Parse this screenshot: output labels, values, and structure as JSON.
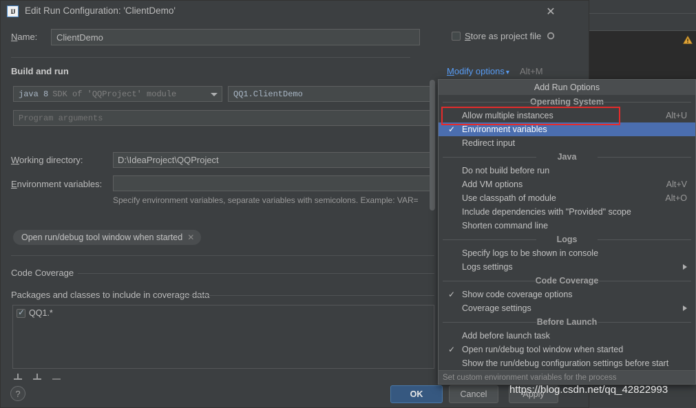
{
  "window": {
    "title": "Edit Run Configuration: 'ClientDemo'",
    "app_icon": "intellij-idea-icon",
    "close_icon": "close-icon"
  },
  "form": {
    "name_label": "Name:",
    "name_value": "ClientDemo",
    "store_as_project_file_label": "Store as project file",
    "store_as_project_file_checked": false,
    "gear_icon": "gear-icon"
  },
  "build_and_run": {
    "section_title": "Build and run",
    "modify_options_label": "Modify options",
    "modify_options_accel": "Alt+M",
    "jre_combo_bold": "java 8",
    "jre_combo_muted": "SDK of 'QQProject' module",
    "main_class": "QQ1.ClientDemo",
    "program_arguments_placeholder": "Program arguments",
    "working_directory_label": "Working directory:",
    "working_directory_value": "D:\\IdeaProject\\QQProject",
    "environment_variables_label": "Environment variables:",
    "environment_variables_value": "",
    "environment_variables_hint": "Specify environment variables, separate variables with semicolons. Example: VAR=",
    "tag_label": "Open run/debug tool window when started",
    "tag_close_icon": "close-icon"
  },
  "code_coverage": {
    "section_title": "Code Coverage",
    "packages_title": "Packages and classes to include in coverage data",
    "rows": [
      {
        "label": "QQ1.*",
        "checked": true
      }
    ],
    "toolbar": [
      {
        "name": "add-package-button",
        "glyph": "+"
      },
      {
        "name": "add-class-button",
        "glyph": "+"
      },
      {
        "name": "remove-button",
        "glyph": "−"
      }
    ]
  },
  "footer": {
    "help_label": "?",
    "ok_label": "OK",
    "cancel_label": "Cancel",
    "apply_label": "Apply"
  },
  "menu": {
    "title": "Add Run Options",
    "status_text": "Set custom environment variables for the process",
    "sections": [
      {
        "group": "Operating System",
        "items": [
          {
            "label": "Allow multiple instances",
            "accel": "Alt+U",
            "checked": false,
            "selected": false,
            "submenu": false,
            "highlighted": true
          },
          {
            "label": "Environment variables",
            "accel": "",
            "checked": true,
            "selected": true,
            "submenu": false,
            "highlighted": false
          },
          {
            "label": "Redirect input",
            "accel": "",
            "checked": false,
            "selected": false,
            "submenu": false,
            "highlighted": false
          }
        ]
      },
      {
        "group": "Java",
        "items": [
          {
            "label": "Do not build before run",
            "accel": "",
            "checked": false,
            "selected": false,
            "submenu": false,
            "highlighted": false
          },
          {
            "label": "Add VM options",
            "accel": "Alt+V",
            "checked": false,
            "selected": false,
            "submenu": false,
            "highlighted": false
          },
          {
            "label": "Use classpath of module",
            "accel": "Alt+O",
            "checked": false,
            "selected": false,
            "submenu": false,
            "highlighted": false
          },
          {
            "label": "Include dependencies with \"Provided\" scope",
            "accel": "",
            "checked": false,
            "selected": false,
            "submenu": false,
            "highlighted": false
          },
          {
            "label": "Shorten command line",
            "accel": "",
            "checked": false,
            "selected": false,
            "submenu": false,
            "highlighted": false
          }
        ]
      },
      {
        "group": "Logs",
        "items": [
          {
            "label": "Specify logs to be shown in console",
            "accel": "",
            "checked": false,
            "selected": false,
            "submenu": false,
            "highlighted": false
          },
          {
            "label": "Logs settings",
            "accel": "",
            "checked": false,
            "selected": false,
            "submenu": true,
            "highlighted": false
          }
        ]
      },
      {
        "group": "Code Coverage",
        "items": [
          {
            "label": "Show code coverage options",
            "accel": "",
            "checked": true,
            "selected": false,
            "submenu": false,
            "highlighted": false
          },
          {
            "label": "Coverage settings",
            "accel": "",
            "checked": false,
            "selected": false,
            "submenu": true,
            "highlighted": false
          }
        ]
      },
      {
        "group": "Before Launch",
        "items": [
          {
            "label": "Add before launch task",
            "accel": "",
            "checked": false,
            "selected": false,
            "submenu": false,
            "highlighted": false
          },
          {
            "label": "Open run/debug tool window when started",
            "accel": "",
            "checked": true,
            "selected": false,
            "submenu": false,
            "highlighted": false
          },
          {
            "label": "Show the run/debug configuration settings before start",
            "accel": "",
            "checked": false,
            "selected": false,
            "submenu": false,
            "highlighted": false
          }
        ]
      }
    ]
  },
  "annotation": {
    "highlight_color": "#e52b2b"
  },
  "background": {
    "warning_icon": "warning-triangle-icon"
  },
  "watermark": {
    "text": "https://blog.csdn.net/qq_42822993"
  },
  "colors": {
    "dialog_bg": "#3c3f41",
    "field_bg": "#45494a",
    "accent_blue": "#365880",
    "menu_selection": "#4b6eaf",
    "link": "#589df6"
  }
}
